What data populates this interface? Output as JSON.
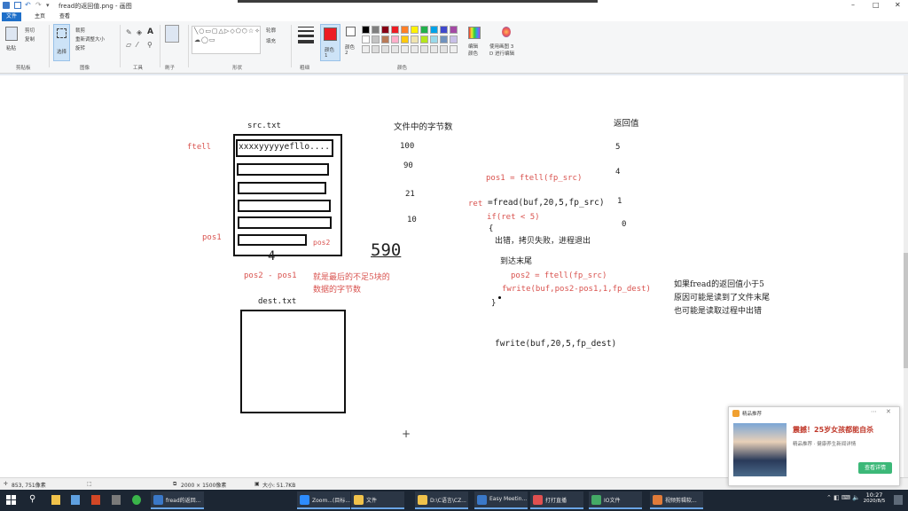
{
  "window": {
    "title": "fread的返回值.png - 画图",
    "controls": {
      "minimize": "–",
      "maximize": "□",
      "close": "✕"
    }
  },
  "tabs": {
    "file": "文件",
    "home": "主页",
    "view": "查看"
  },
  "ribbon": {
    "clipboard": {
      "paste": "粘贴",
      "cut": "剪切",
      "copy": "复制",
      "label": "剪贴板"
    },
    "image": {
      "select": "选择",
      "crop": "裁剪",
      "resize": "重新调整大小",
      "rotate": "旋转",
      "label": "图像"
    },
    "tools": {
      "label": "工具"
    },
    "brushes": {
      "label": "刷子"
    },
    "shapes": {
      "outline": "轮廓",
      "fill": "填充",
      "label": "形状"
    },
    "size": {
      "label": "粗细"
    },
    "colors": {
      "color1": "颜色\n1",
      "color2": "颜色\n2",
      "edit": "编辑\n颜色",
      "paint3d": "使用画图 3\nD 进行编辑",
      "label": "颜色"
    },
    "palette": [
      "#000000",
      "#7f7f7f",
      "#880015",
      "#ed1c24",
      "#ff7f27",
      "#fff200",
      "#22b14c",
      "#00a2e8",
      "#3f48cc",
      "#a349a4",
      "#ffffff",
      "#c3c3c3",
      "#b97a57",
      "#ffaec9",
      "#ffc90e",
      "#efe4b0",
      "#b5e61d",
      "#99d9ea",
      "#7092be",
      "#c8bfe7",
      "#eeeeee",
      "#dddddd",
      "#e0e0e0",
      "#e6e6e6",
      "#ececec",
      "#eaeaea",
      "#e4e4e4",
      "#e8e8e8",
      "#e2e2e2",
      "#efefef"
    ],
    "color1_value": "#ed1c24",
    "color2_value": "#ffffff"
  },
  "drawing": {
    "src_label": "src.txt",
    "dest_label": "dest.txt",
    "ftell": "ftell",
    "pos1": "pos1",
    "pos2_small": "pos2",
    "src_first_line": "xxxxyyyyyefllo....",
    "num_4": "4",
    "num_590": "590",
    "pos_diff": "pos2 - pos1",
    "pos_diff_note_1": "就是最后的不足5块的",
    "pos_diff_note_2": "数据的字节数",
    "bytes_header": "文件中的字节数",
    "bytes": [
      "100",
      "90",
      "21",
      "10"
    ],
    "return_header": "返回值",
    "returns": [
      "5",
      "4",
      "1",
      "0"
    ],
    "code_pos1": "pos1 = ftell(fp_src)",
    "code_ret_prefix": "ret",
    "code_fread": "=fread(buf,20,5,fp_src)",
    "code_if": "if(ret < 5)",
    "code_brace_open": "{",
    "code_error": "出错，拷贝失败，进程退出",
    "code_eof": "到达末尾",
    "code_pos2": "pos2 = ftell(fp_src)",
    "code_fwrite_partial": "fwrite(buf,pos2-pos1,1,fp_dest)",
    "code_brace_close": "}",
    "code_fwrite": "fwrite(buf,20,5,fp_dest)",
    "note_line1": "如果fread的返回值小于5",
    "note_line2": "原因可能是读到了文件末尾",
    "note_line3": "也可能是读取过程中出错"
  },
  "status": {
    "cursor": "853, 751像素",
    "size": "2000 × 1500像素",
    "filesize": "大小: 51.7KB"
  },
  "popup": {
    "header": "精品推荐",
    "headline": "震撼！25岁女孩都能自杀",
    "sub": "精品推荐 · 健康养生新闻详情",
    "button": "查看详情"
  },
  "taskbar": {
    "apps": [
      {
        "label": "fread的返回...",
        "color": "#3a78c8"
      },
      {
        "label": "Zoom...(目标...",
        "color": "#2d8cff"
      },
      {
        "label": "文件",
        "color": "#f0c24b"
      },
      {
        "label": "D:\\C语言\\CZ...",
        "color": "#f0c24b"
      },
      {
        "label": "Easy Meetin...",
        "color": "#3a78c8"
      },
      {
        "label": "打打直播",
        "color": "#e05050"
      },
      {
        "label": "IO文件",
        "color": "#44aa66"
      },
      {
        "label": "视频剪辑软...",
        "color": "#e07b39"
      }
    ],
    "time": "10:27",
    "date": "2020/8/5"
  }
}
